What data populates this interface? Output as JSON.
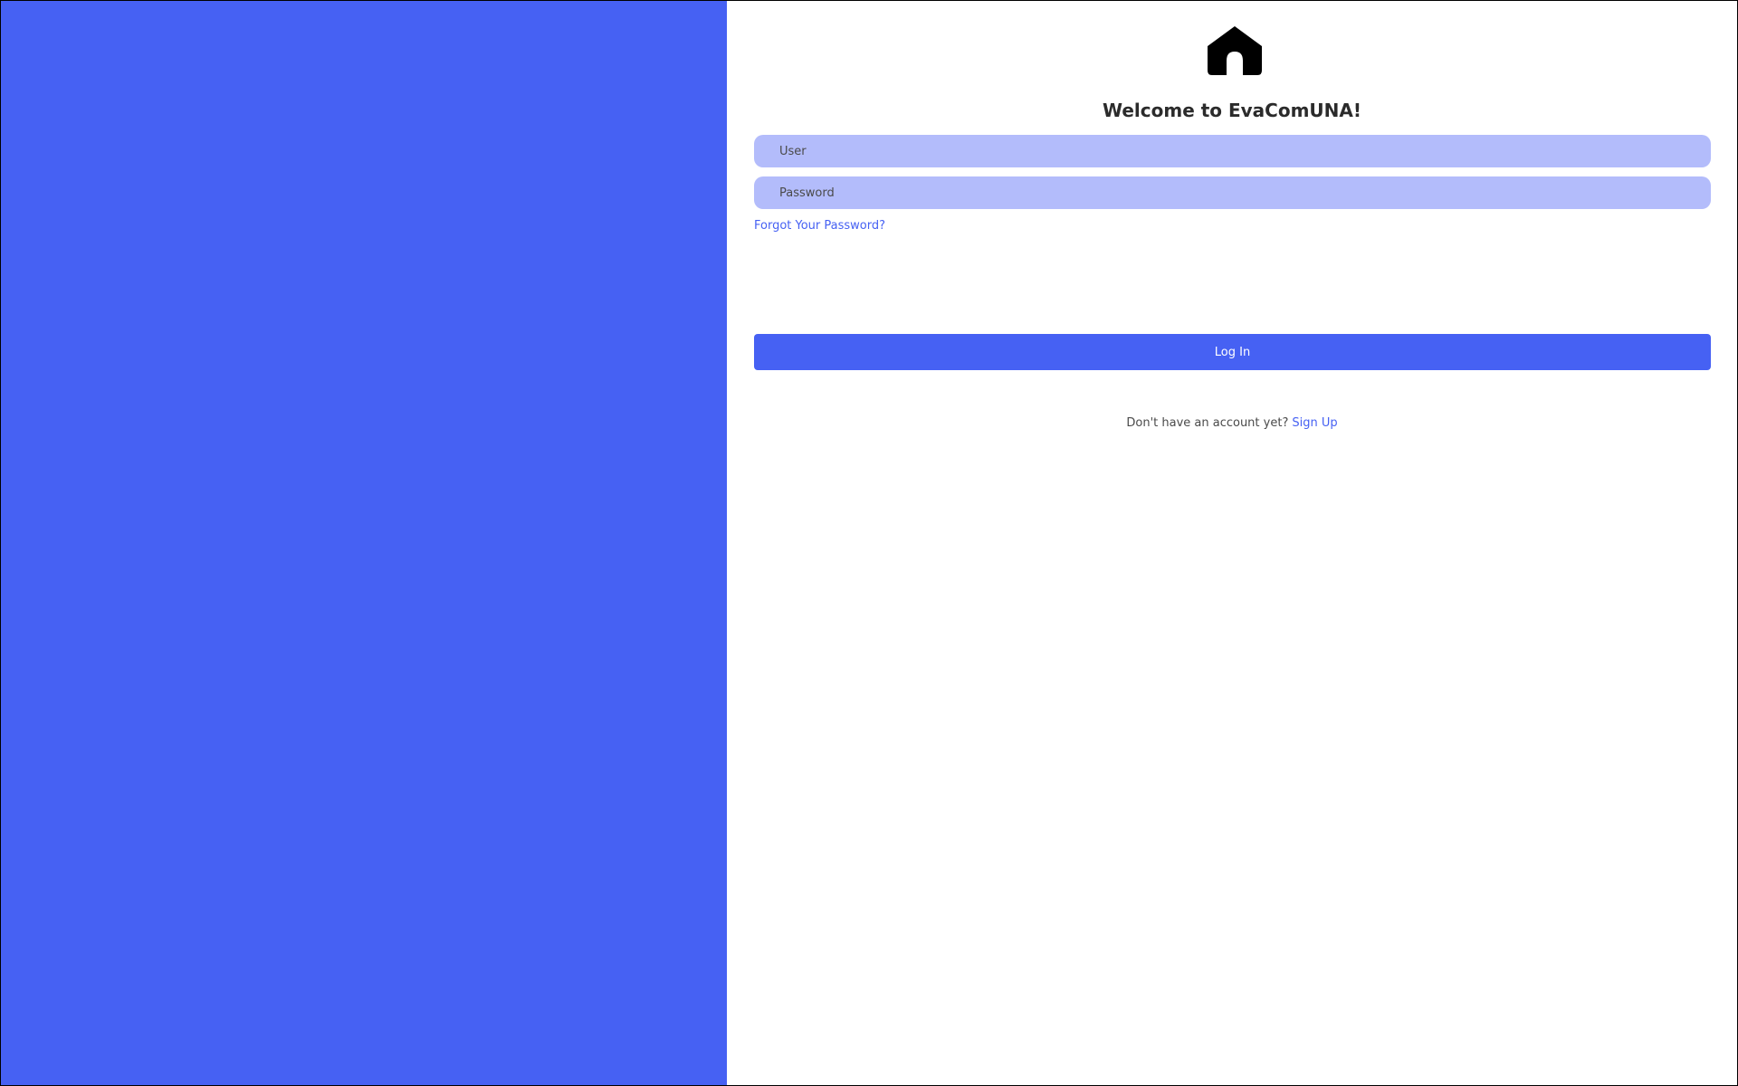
{
  "app": {
    "title": "Welcome to EvaComUNA!",
    "logo_icon": "home-icon"
  },
  "form": {
    "user_placeholder": "User",
    "password_placeholder": "Password",
    "user_value": "",
    "password_value": "",
    "forgot_link": "Forgot Your Password?",
    "login_label": "Log In"
  },
  "footer": {
    "prompt": "Don't have an account yet?",
    "signup_link": "Sign Up"
  },
  "colors": {
    "accent": "#4661f3",
    "input_bg": "#b3bcfb",
    "background": "#ffffff"
  }
}
